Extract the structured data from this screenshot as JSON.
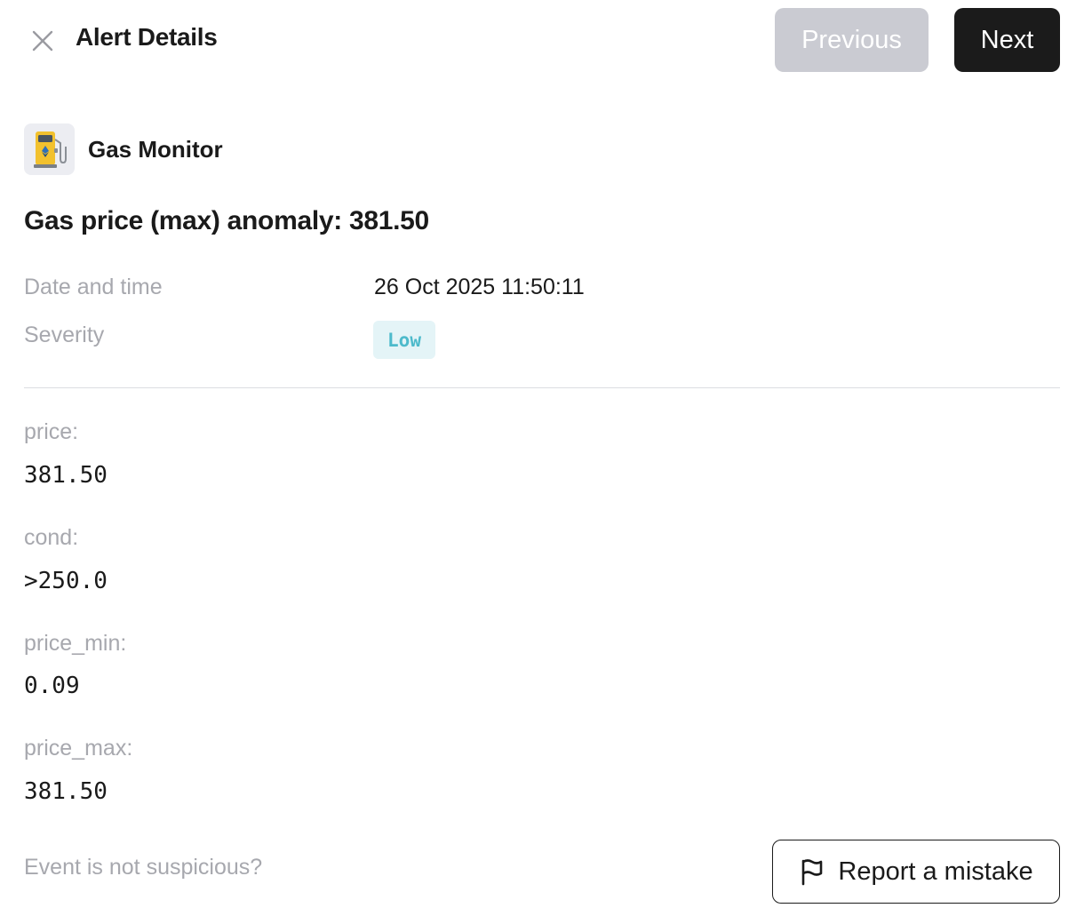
{
  "header": {
    "title": "Alert Details",
    "close_icon": "close-icon",
    "previous_label": "Previous",
    "next_label": "Next"
  },
  "monitor": {
    "icon": "gas-pump-icon",
    "name": "Gas Monitor"
  },
  "alert": {
    "title": "Gas price (max) anomaly: 381.50"
  },
  "meta": {
    "date_label": "Date and time",
    "date_value": "26 Oct 2025 11:50:11",
    "severity_label": "Severity",
    "severity_value": "Low"
  },
  "fields": [
    {
      "label": "price:",
      "value": "381.50"
    },
    {
      "label": "cond:",
      "value": ">250.0"
    },
    {
      "label": "price_min:",
      "value": "0.09"
    },
    {
      "label": "price_max:",
      "value": "381.50"
    }
  ],
  "footer": {
    "question": "Event is not suspicious?",
    "report_icon": "flag-icon",
    "report_label": "Report a mistake"
  },
  "colors": {
    "previous_disabled": "#cacbd2",
    "next_bg": "#1b1b1b",
    "severity_low_text": "#4dbacb",
    "severity_low_bg": "#e4f4f7",
    "muted_text": "#a7a8ae"
  }
}
